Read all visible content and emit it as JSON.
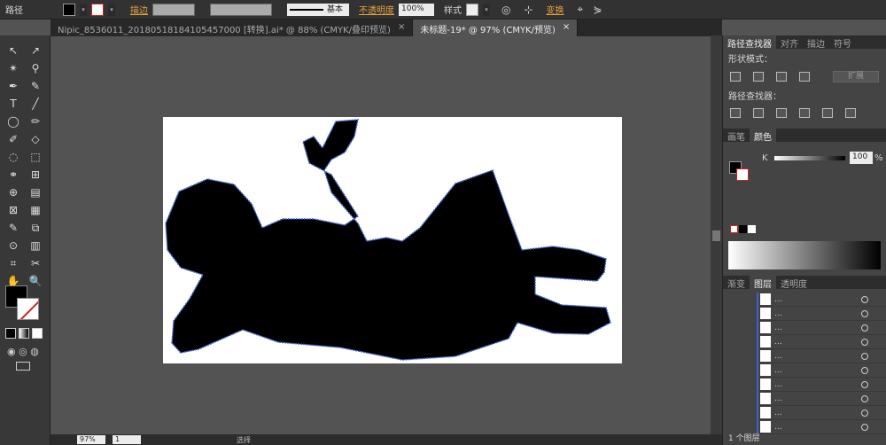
{
  "control_bar": {
    "title": "路径",
    "stroke_label": "描边",
    "stroke_profile": "基本",
    "opacity_label": "不透明度",
    "opacity_value": "100%",
    "style_label": "样式",
    "transform_label": "变换"
  },
  "doc_tabs": [
    {
      "label": "Nipic_8536011_20180518184105457000 [转换].ai* @ 88% (CMYK/叠印预览)",
      "close": "×"
    },
    {
      "label": "未标题-19* @ 97% (CMYK/预览)",
      "close": "×"
    }
  ],
  "tools": [
    "↖",
    "↗",
    "✴",
    "⚲",
    "✒",
    "✎",
    "T",
    "╱",
    "◯",
    "✏",
    "✐",
    "◇",
    "◌",
    "⬚",
    "⚭",
    "⊞",
    "⊕",
    "▤",
    "⊠",
    "▦",
    "✎",
    "⧉",
    "⊙",
    "▥",
    "⌗",
    "✂",
    "✋",
    "🔍"
  ],
  "pathfinder": {
    "tabs": [
      "路径查找器",
      "对齐",
      "描边",
      "符号"
    ],
    "shape_modes": "形状模式：",
    "expand": "扩展",
    "pathfinders": "路径查找器："
  },
  "color": {
    "tabs": [
      "画笔",
      "颜色"
    ],
    "k_label": "K",
    "k_value": "100",
    "percent": "%"
  },
  "layers": {
    "tabs": [
      "渐变",
      "图层",
      "透明度"
    ],
    "rows": [
      "...",
      "...",
      "...",
      "...",
      "...",
      "...",
      "...",
      "...",
      "...",
      "..."
    ],
    "footer": "1 个图层"
  },
  "status": {
    "zoom": "97%",
    "page": "1",
    "tool": "选择"
  },
  "colors": {
    "accent": "#e8a23b",
    "silhouette": "#000000",
    "path": "#3d5fd0"
  }
}
